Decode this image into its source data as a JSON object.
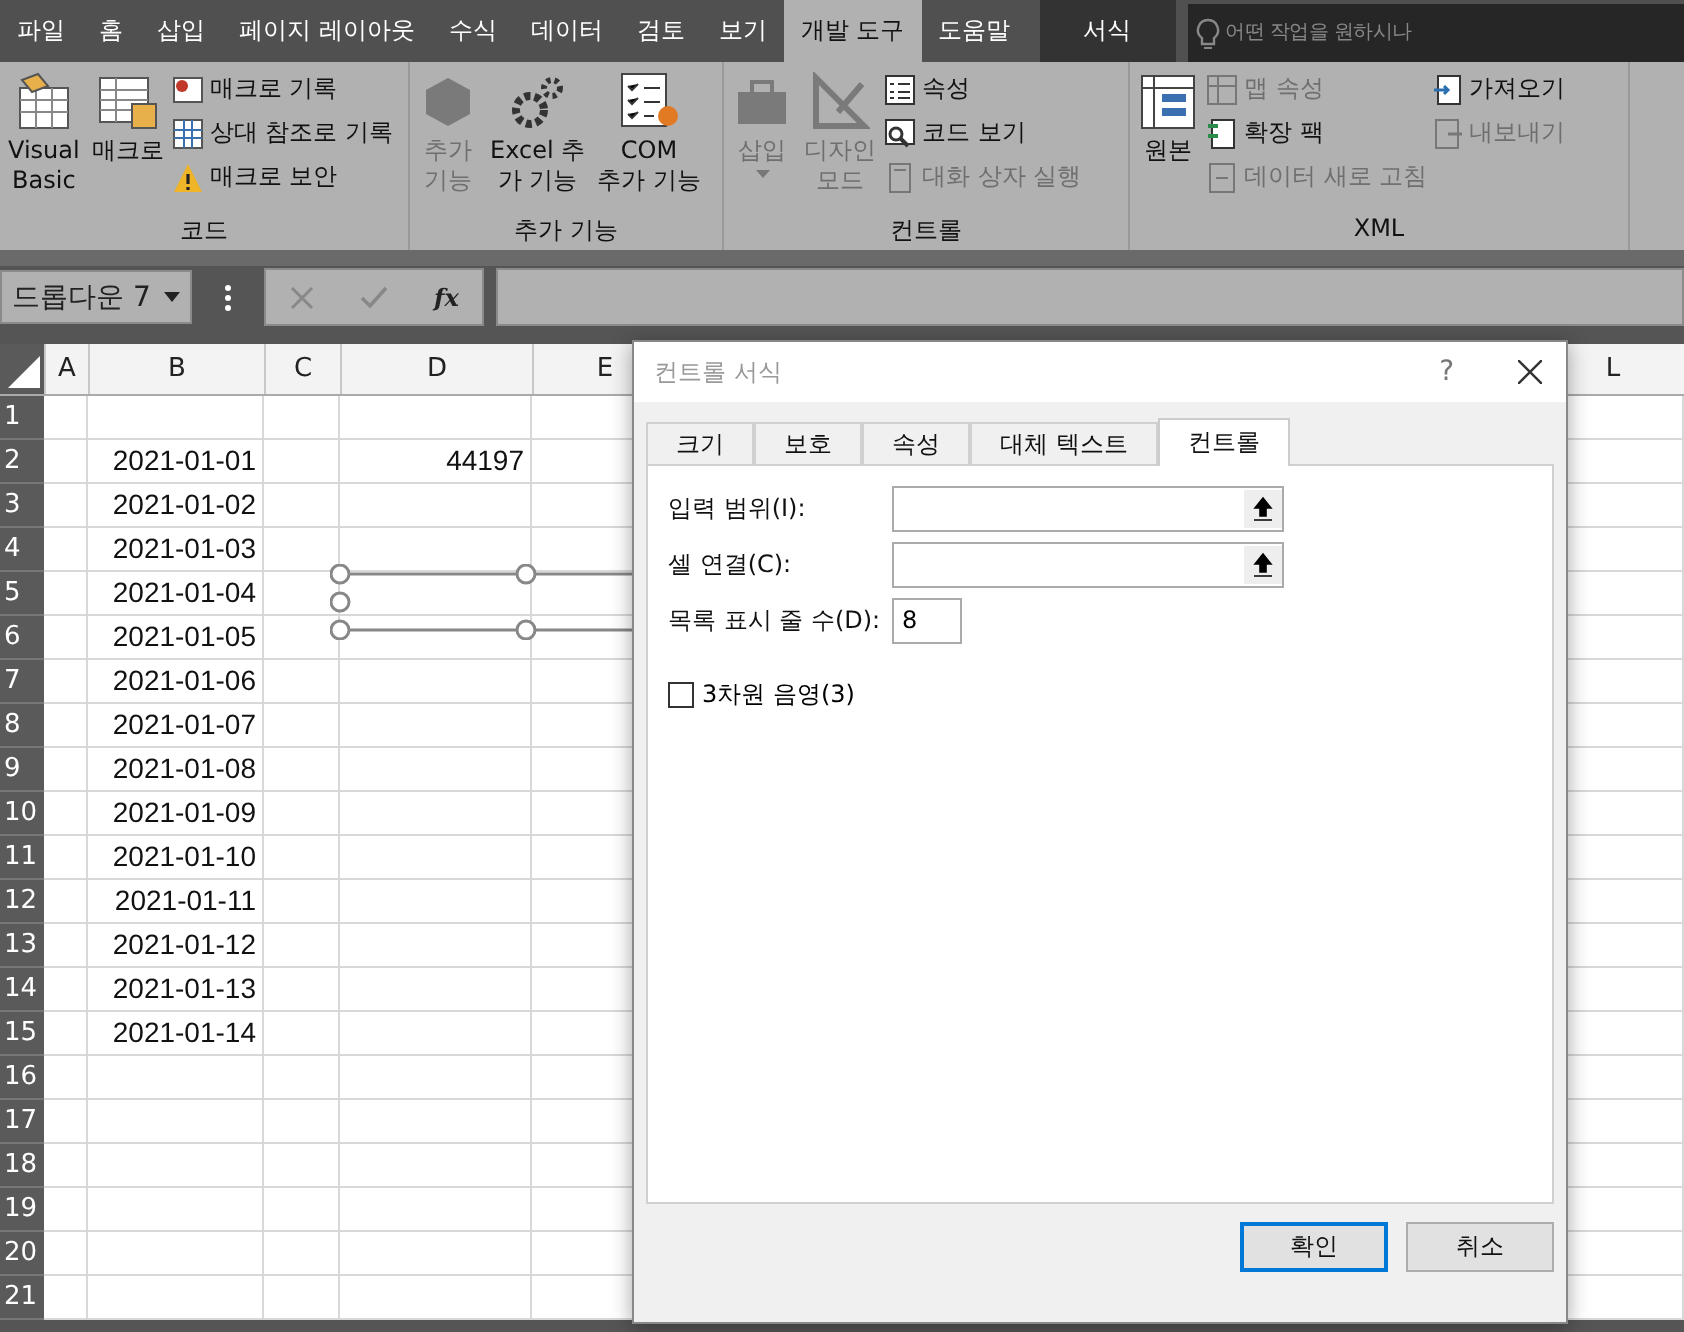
{
  "ribbon_tabs": [
    {
      "label": "파일",
      "selected": false,
      "contextual": false
    },
    {
      "label": "홈",
      "selected": false,
      "contextual": false
    },
    {
      "label": "삽입",
      "selected": false,
      "contextual": false
    },
    {
      "label": "페이지 레이아웃",
      "selected": false,
      "contextual": false
    },
    {
      "label": "수식",
      "selected": false,
      "contextual": false
    },
    {
      "label": "데이터",
      "selected": false,
      "contextual": false
    },
    {
      "label": "검토",
      "selected": false,
      "contextual": false
    },
    {
      "label": "보기",
      "selected": false,
      "contextual": false
    },
    {
      "label": "개발 도구",
      "selected": true,
      "contextual": false
    },
    {
      "label": "도움말",
      "selected": false,
      "contextual": false
    },
    {
      "label": "서식",
      "selected": false,
      "contextual": true
    }
  ],
  "search": {
    "placeholder": "어떤 작업을 원하시나"
  },
  "ribbon_groups": [
    {
      "label": "코드",
      "items": [
        {
          "kind": "large",
          "label": "Visual\nBasic",
          "disabled": false,
          "dropdown": false
        },
        {
          "kind": "large",
          "label": "매크로",
          "disabled": false,
          "dropdown": false
        },
        {
          "kind": "stack",
          "items": [
            {
              "label": "매크로 기록",
              "disabled": false
            },
            {
              "label": "상대 참조로 기록",
              "disabled": false
            },
            {
              "label": "매크로 보안",
              "disabled": false
            }
          ]
        }
      ]
    },
    {
      "label": "추가 기능",
      "items": [
        {
          "kind": "large",
          "label": "추가\n기능",
          "disabled": true,
          "dropdown": false
        },
        {
          "kind": "large",
          "label": "Excel 추\n가 기능",
          "disabled": false,
          "dropdown": false
        },
        {
          "kind": "large",
          "label": "COM\n추가 기능",
          "disabled": false,
          "dropdown": false
        }
      ]
    },
    {
      "label": "컨트롤",
      "items": [
        {
          "kind": "large",
          "label": "삽입",
          "disabled": true,
          "dropdown": true
        },
        {
          "kind": "large",
          "label": "디자인\n모드",
          "disabled": true,
          "dropdown": false
        },
        {
          "kind": "stack",
          "items": [
            {
              "label": "속성",
              "disabled": false
            },
            {
              "label": "코드 보기",
              "disabled": false
            },
            {
              "label": "대화 상자 실행",
              "disabled": true
            }
          ]
        }
      ]
    },
    {
      "label": "XML",
      "items": [
        {
          "kind": "large",
          "label": "원본",
          "disabled": false,
          "dropdown": false
        },
        {
          "kind": "stack",
          "items": [
            {
              "label": "맵 속성",
              "disabled": true
            },
            {
              "label": "확장 팩",
              "disabled": false
            },
            {
              "label": "데이터 새로 고침",
              "disabled": true
            }
          ]
        },
        {
          "kind": "stack",
          "items": [
            {
              "label": "가져오기",
              "disabled": false
            },
            {
              "label": "내보내기",
              "disabled": true
            }
          ]
        }
      ]
    }
  ],
  "name_box": {
    "value": "드롭다운 7"
  },
  "formula_bar": {
    "function_label": "fx"
  },
  "sheet": {
    "columns": [
      "A",
      "B",
      "C",
      "D",
      "E",
      "L"
    ],
    "rows": [
      {
        "num": "1",
        "b": "",
        "d": ""
      },
      {
        "num": "2",
        "b": "2021-01-01",
        "d": "44197"
      },
      {
        "num": "3",
        "b": "2021-01-02"
      },
      {
        "num": "4",
        "b": "2021-01-03"
      },
      {
        "num": "5",
        "b": "2021-01-04"
      },
      {
        "num": "6",
        "b": "2021-01-05"
      },
      {
        "num": "7",
        "b": "2021-01-06"
      },
      {
        "num": "8",
        "b": "2021-01-07"
      },
      {
        "num": "9",
        "b": "2021-01-08"
      },
      {
        "num": "10",
        "b": "2021-01-09"
      },
      {
        "num": "11",
        "b": "2021-01-10"
      },
      {
        "num": "12",
        "b": "2021-01-11"
      },
      {
        "num": "13",
        "b": "2021-01-12"
      },
      {
        "num": "14",
        "b": "2021-01-13"
      },
      {
        "num": "15",
        "b": "2021-01-14"
      },
      {
        "num": "16"
      },
      {
        "num": "17"
      },
      {
        "num": "18"
      },
      {
        "num": "19"
      },
      {
        "num": "20"
      },
      {
        "num": "21"
      }
    ]
  },
  "dialog": {
    "title": "컨트롤 서식",
    "help": "?",
    "tabs": [
      {
        "label": "크기",
        "selected": false
      },
      {
        "label": "보호",
        "selected": false
      },
      {
        "label": "속성",
        "selected": false
      },
      {
        "label": "대체 텍스트",
        "selected": false
      },
      {
        "label": "컨트롤",
        "selected": true
      }
    ],
    "fields": [
      {
        "kind": "range",
        "label": "입력 범위(I):"
      },
      {
        "kind": "range",
        "label": "셀 연결(C):"
      },
      {
        "kind": "number",
        "label": "목록 표시 줄 수(D):",
        "value": "8"
      }
    ],
    "checkbox": {
      "label": "3차원 음영(3)",
      "checked": false
    },
    "buttons": [
      {
        "label": "확인",
        "default": true
      },
      {
        "label": "취소",
        "default": false
      }
    ]
  }
}
